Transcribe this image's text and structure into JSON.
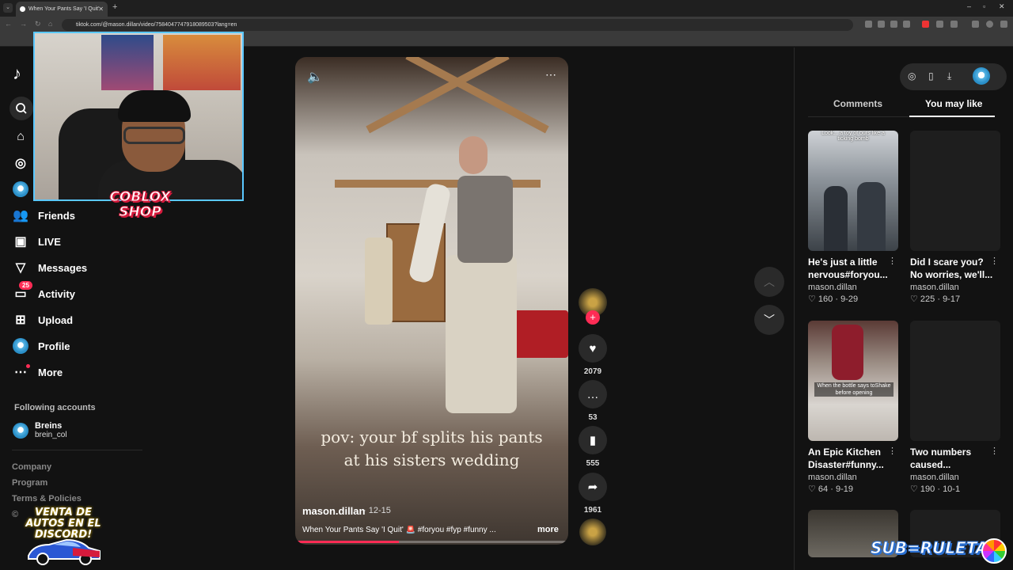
{
  "browser": {
    "tab_title": "When Your Pants Say 'I Quit'",
    "url": "tiktok.com/@mason.dillan/video/7584047747918089503?lang=en"
  },
  "sidebar": {
    "logo": "♪",
    "items": [
      {
        "label": "Friends",
        "icon": "friends-icon"
      },
      {
        "label": "LIVE",
        "icon": "live-icon"
      },
      {
        "label": "Messages",
        "icon": "messages-icon"
      },
      {
        "label": "Activity",
        "icon": "activity-icon",
        "badge": "25"
      },
      {
        "label": "Upload",
        "icon": "upload-icon"
      },
      {
        "label": "Profile",
        "icon": "profile-icon"
      },
      {
        "label": "More",
        "icon": "more-icon"
      }
    ],
    "following_title": "Following accounts",
    "following": [
      {
        "name": "Breins",
        "handle": "brein_col"
      }
    ],
    "footer": [
      "Company",
      "Program",
      "Terms & Policies",
      "©"
    ]
  },
  "overlays": {
    "coblox": "COBLOX SHOP",
    "venta": "VENTA DE AUTOS EN EL DISCORD!",
    "subruleta": "SUB=RULETA"
  },
  "video": {
    "caption_line1": "pov: your bf splits his pants",
    "caption_line2": "at his sisters wedding",
    "author": "mason.dillan",
    "date": "· 12-15",
    "description": "When Your Pants Say 'I Quit' 🚨 #foryou #fyp #funny ...",
    "more": "more",
    "progress": 0.38
  },
  "actions": {
    "likes": "2079",
    "comments": "53",
    "saves": "555",
    "shares": "1961"
  },
  "right_panel": {
    "tabs": [
      "Comments",
      "You may like"
    ],
    "active_tab": "You may like",
    "cards": [
      {
        "title": "He's just a little nervous#foryou...",
        "author": "mason.dillan",
        "likes": "160",
        "date": "9-29",
        "thumb_text": "Look... a toy of ours like a ticking bomb"
      },
      {
        "title": "Did I scare you? No worries, we'll...",
        "author": "mason.dillan",
        "likes": "225",
        "date": "9-17",
        "thumb_text": ""
      },
      {
        "title": "An Epic Kitchen Disaster#funny...",
        "author": "mason.dillan",
        "likes": "64",
        "date": "9-19",
        "thumb_text": "When the bottle says toShake before opening"
      },
      {
        "title": "Two numbers caused...",
        "author": "mason.dillan",
        "likes": "190",
        "date": "10-1",
        "thumb_text": ""
      }
    ]
  }
}
